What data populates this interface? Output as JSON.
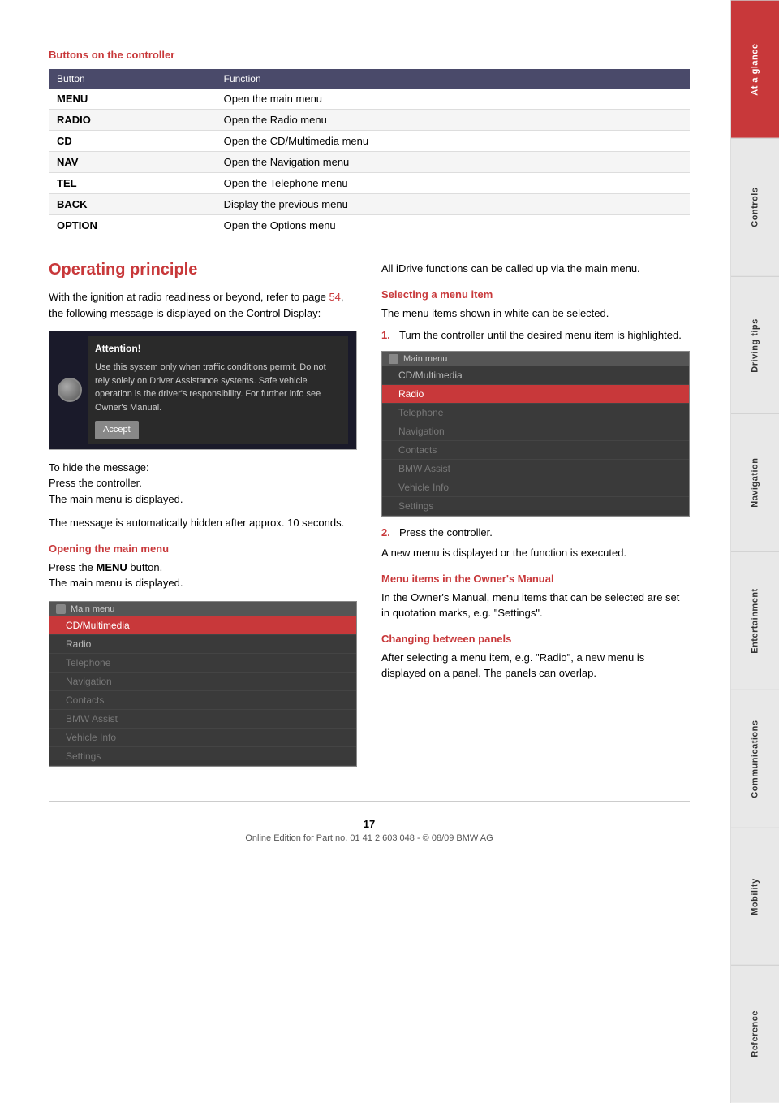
{
  "sidebar": {
    "tabs": [
      {
        "id": "at-a-glance",
        "label": "At a glance",
        "active": true
      },
      {
        "id": "controls",
        "label": "Controls",
        "active": false
      },
      {
        "id": "driving-tips",
        "label": "Driving tips",
        "active": false
      },
      {
        "id": "navigation",
        "label": "Navigation",
        "active": false
      },
      {
        "id": "entertainment",
        "label": "Entertainment",
        "active": false
      },
      {
        "id": "communications",
        "label": "Communications",
        "active": false
      },
      {
        "id": "mobility",
        "label": "Mobility",
        "active": false
      },
      {
        "id": "reference",
        "label": "Reference",
        "active": false
      }
    ]
  },
  "buttons_section": {
    "title": "Buttons on the controller",
    "table": {
      "headers": [
        "Button",
        "Function"
      ],
      "rows": [
        [
          "MENU",
          "Open the main menu"
        ],
        [
          "RADIO",
          "Open the Radio menu"
        ],
        [
          "CD",
          "Open the CD/Multimedia menu"
        ],
        [
          "NAV",
          "Open the Navigation menu"
        ],
        [
          "TEL",
          "Open the Telephone menu"
        ],
        [
          "BACK",
          "Display the previous menu"
        ],
        [
          "OPTION",
          "Open the Options menu"
        ]
      ]
    }
  },
  "operating_principle": {
    "title": "Operating principle",
    "intro_text": "With the ignition at radio readiness or beyond, refer to page ",
    "intro_link": "54",
    "intro_text2": ", the following message is displayed on the Control Display:",
    "attention_box": {
      "title": "Attention!",
      "text": "Use this system only when traffic conditions permit. Do not rely solely on Driver Assistance systems. Safe vehicle operation is the driver's responsibility. For further info see Owner's Manual.",
      "accept_btn": "Accept"
    },
    "hide_message_text": "To hide the message:\nPress the controller.\nThe main menu is displayed.",
    "auto_hide_text": "The message is automatically hidden after approx. 10 seconds.",
    "opening_main_menu": {
      "heading": "Opening the main menu",
      "text1": "Press the ",
      "bold": "MENU",
      "text2": " button.\nThe main menu is displayed."
    },
    "main_menu_items_1": [
      "CD/Multimedia",
      "Radio",
      "Telephone",
      "Navigation",
      "Contacts",
      "BMW Assist",
      "Vehicle Info",
      "Settings"
    ],
    "right_col": {
      "all_idrive_text": "All iDrive functions can be called up via the main menu.",
      "selecting_heading": "Selecting a menu item",
      "selecting_text": "The menu items shown in white can be selected.",
      "step1": "Turn the controller until the desired menu item is highlighted.",
      "main_menu_items_2": [
        "CD/Multimedia",
        "Radio",
        "Telephone",
        "Navigation",
        "Contacts",
        "BMW Assist",
        "Vehicle Info",
        "Settings"
      ],
      "step2": "Press the controller.",
      "step2_result": "A new menu is displayed or the function is executed.",
      "owners_manual_heading": "Menu items in the Owner's Manual",
      "owners_manual_text": "In the Owner's Manual, menu items that can be selected are set in quotation marks, e.g. \"Settings\".",
      "changing_panels_heading": "Changing between panels",
      "changing_panels_text": "After selecting a menu item, e.g. \"Radio\", a new menu is displayed on a panel. The panels can overlap."
    }
  },
  "footer": {
    "page_number": "17",
    "copyright": "Online Edition for Part no. 01 41 2 603 048 - © 08/09 BMW AG"
  }
}
